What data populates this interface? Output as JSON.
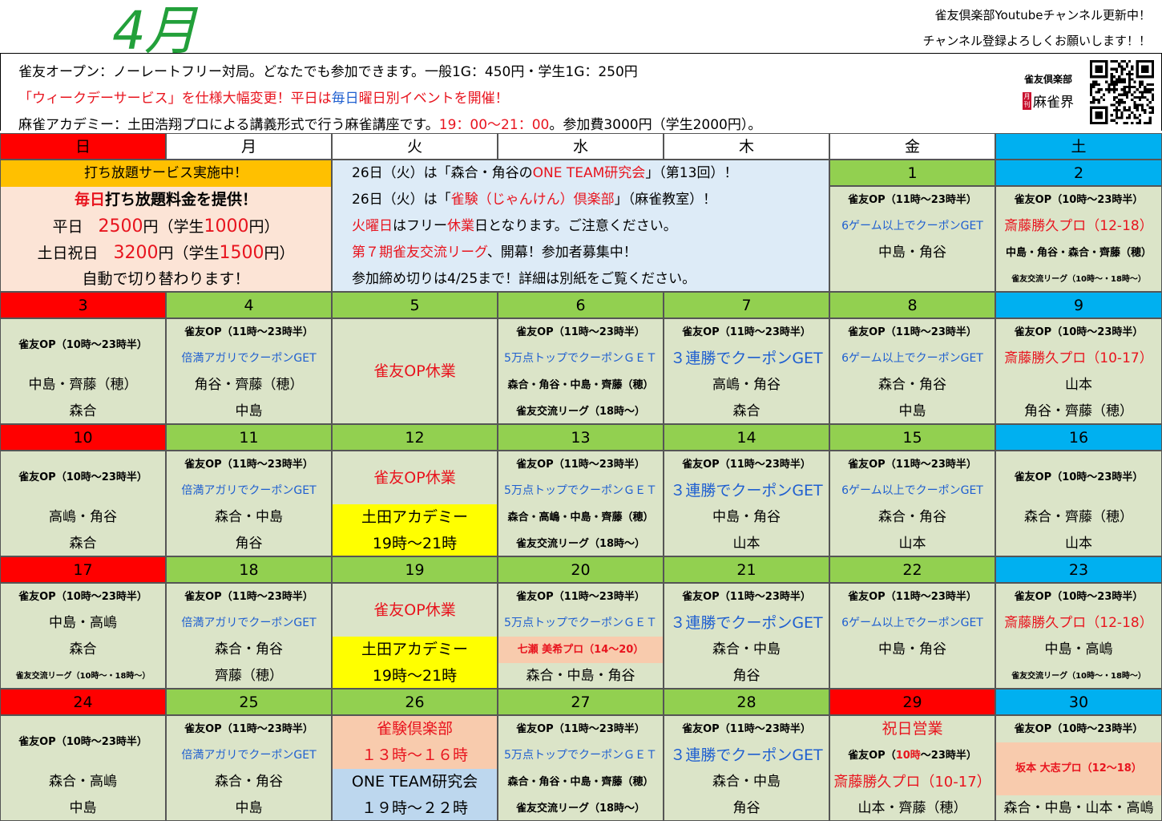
{
  "header": {
    "month": "4月",
    "top_right_1": "雀友倶楽部Youtubeチャンネル更新中！",
    "top_right_2": "チャンネル登録よろしくお願いします！！"
  },
  "info": {
    "line1": "雀友オープン：ノーレートフリー対局。どなたでも参加できます。一般1G：450円・学生1G：250円",
    "line2_a": "「ウィークデーサービス」を仕様大幅変更！平日は",
    "line2_b": "毎日",
    "line2_c": "曜日別イベントを開催！",
    "line3_a": "麻雀アカデミー：土田浩翔プロによる講義形式で行う麻雀講座です。",
    "line3_b": "19：00〜21：00",
    "line3_c": "。参加費3000円（学生2000円）。",
    "logo_top": "雀友倶楽部",
    "logo_badge": "月刊",
    "logo_name": "麻雀界"
  },
  "colors": {
    "green": "#92d050",
    "red": "#ff0000",
    "blue": "#00b0f0",
    "orange": "#ffc000",
    "cellbg": "#dbe4c8",
    "peach": "#fce4d6",
    "lightblue": "#ddebf7",
    "yellow": "#ffff00",
    "salmon": "#f8cbad",
    "skyblue": "#bdd7ee"
  },
  "weekdays": [
    "日",
    "月",
    "火",
    "水",
    "木",
    "金",
    "土"
  ],
  "banners": {
    "sunday_title": "打ち放題サービス実施中！",
    "sunday_lines": [
      "毎日打ち放題料金を提供！",
      "平日　2500円（学生1000円）",
      "土日祝日　3200円（学生1500円）",
      "自動で切り替わります！"
    ],
    "notice_lines": [
      "26日（火）は「森合・角谷のONE TEAM研究会」（第13回）！",
      "26日（火）は「雀験（じゃんけん）倶楽部」（麻雀教室）！",
      "火曜日はフリー休業日となります。ご注意ください。",
      "第７期雀友交流リーグ、開幕！参加者募集中！",
      "参加締め切りは4/25まで！詳細は別紙をご覧ください。"
    ]
  },
  "weeks": [
    {
      "days": [
        null,
        null,
        null,
        null,
        null,
        {
          "date": "1",
          "lines": [
            "雀友OP（11時〜23時半）",
            "6ゲーム以上でクーポンGET",
            "中島・角谷",
            ""
          ]
        },
        {
          "date": "2",
          "lines": [
            "雀友OP（10時〜23時半）",
            "斎藤勝久プロ（12-18）",
            "中島・角谷・森合・齊藤（穂）",
            "雀友交流リーグ（10時〜・18時〜）"
          ]
        }
      ]
    },
    {
      "days": [
        {
          "date": "3",
          "lines": [
            "雀友OP（10時〜23時半）",
            "中島・齊藤（穂）",
            "森合"
          ]
        },
        {
          "date": "4",
          "lines": [
            "雀友OP（11時〜23時半）",
            "倍満アガリでクーポンGET",
            "角谷・齊藤（穂）",
            "中島"
          ]
        },
        {
          "date": "5",
          "lines": [
            "雀友OP休業"
          ]
        },
        {
          "date": "6",
          "lines": [
            "雀友OP（11時〜23時半）",
            "5万点トップでクーポンＧＥＴ",
            "森合・角谷・中島・齊藤（穂）",
            "雀友交流リーグ（18時〜）"
          ]
        },
        {
          "date": "7",
          "lines": [
            "雀友OP（11時〜23時半）",
            "３連勝でクーポンGET",
            "高嶋・角谷",
            "森合"
          ]
        },
        {
          "date": "8",
          "lines": [
            "雀友OP（11時〜23時半）",
            "6ゲーム以上でクーポンGET",
            "森合・角谷",
            "中島"
          ]
        },
        {
          "date": "9",
          "lines": [
            "雀友OP（10時〜23時半）",
            "斎藤勝久プロ（10-17）",
            "山本",
            "角谷・齊藤（穂）"
          ]
        }
      ]
    },
    {
      "days": [
        {
          "date": "10",
          "lines": [
            "雀友OP（10時〜23時半）",
            "高嶋・角谷",
            "森合"
          ]
        },
        {
          "date": "11",
          "lines": [
            "雀友OP（11時〜23時半）",
            "倍満アガリでクーポンGET",
            "森合・中島",
            "角谷"
          ]
        },
        {
          "date": "12",
          "lines": [
            "雀友OP休業",
            "土田アカデミー",
            "19時〜21時"
          ]
        },
        {
          "date": "13",
          "lines": [
            "雀友OP（11時〜23時半）",
            "5万点トップでクーポンＧＥＴ",
            "森合・高嶋・中島・齊藤（穂）",
            "雀友交流リーグ（18時〜）"
          ]
        },
        {
          "date": "14",
          "lines": [
            "雀友OP（11時〜23時半）",
            "３連勝でクーポンGET",
            "中島・角谷",
            "山本"
          ]
        },
        {
          "date": "15",
          "lines": [
            "雀友OP（11時〜23時半）",
            "6ゲーム以上でクーポンGET",
            "森合・角谷",
            "山本"
          ]
        },
        {
          "date": "16",
          "lines": [
            "雀友OP（10時〜23時半）",
            "森合・齊藤（穂）",
            "山本"
          ]
        }
      ]
    },
    {
      "days": [
        {
          "date": "17",
          "lines": [
            "雀友OP（10時〜23時半）",
            "中島・高嶋",
            "森合",
            "雀友交流リーグ（10時〜・18時〜）"
          ]
        },
        {
          "date": "18",
          "lines": [
            "雀友OP（11時〜23時半）",
            "倍満アガリでクーポンGET",
            "森合・角谷",
            "齊藤（穂）"
          ]
        },
        {
          "date": "19",
          "lines": [
            "雀友OP休業",
            "土田アカデミー",
            "19時〜21時"
          ]
        },
        {
          "date": "20",
          "lines": [
            "雀友OP（11時〜23時半）",
            "5万点トップでクーポンＧＥＴ",
            "七瀬 美希プロ（14〜20）",
            "森合・中島・角谷"
          ]
        },
        {
          "date": "21",
          "lines": [
            "雀友OP（11時〜23時半）",
            "３連勝でクーポンGET",
            "森合・中島",
            "角谷"
          ]
        },
        {
          "date": "22",
          "lines": [
            "雀友OP（11時〜23時半）",
            "6ゲーム以上でクーポンGET",
            "中島・角谷",
            ""
          ]
        },
        {
          "date": "23",
          "lines": [
            "雀友OP（10時〜23時半）",
            "斎藤勝久プロ（12-18）",
            "中島・高嶋",
            "雀友交流リーグ（10時〜・18時〜）"
          ]
        }
      ]
    },
    {
      "days": [
        {
          "date": "24",
          "lines": [
            "雀友OP（10時〜23時半）",
            "森合・高嶋",
            "中島"
          ]
        },
        {
          "date": "25",
          "lines": [
            "雀友OP（11時〜23時半）",
            "倍満アガリでクーポンGET",
            "森合・角谷",
            "中島"
          ]
        },
        {
          "date": "26",
          "lines": [
            "雀験倶楽部",
            "１３時〜１６時",
            "ONE TEAM研究会",
            "１９時〜２２時"
          ]
        },
        {
          "date": "27",
          "lines": [
            "雀友OP（11時〜23時半）",
            "5万点トップでクーポンＧＥＴ",
            "森合・角谷・中島・齊藤（穂）",
            "雀友交流リーグ（18時〜）"
          ]
        },
        {
          "date": "28",
          "lines": [
            "雀友OP（11時〜23時半）",
            "３連勝でクーポンGET",
            "森合・中島",
            "角谷"
          ]
        },
        {
          "date": "29",
          "lines": [
            "祝日営業",
            "雀友OP（10時〜23時半）",
            "斎藤勝久プロ（10-17）",
            "山本・齊藤（穂）"
          ]
        },
        {
          "date": "30",
          "lines": [
            "雀友OP（10時〜23時半）",
            "坂本 大志プロ（12〜18）",
            "森合・中島・山本・高嶋"
          ]
        }
      ]
    }
  ]
}
